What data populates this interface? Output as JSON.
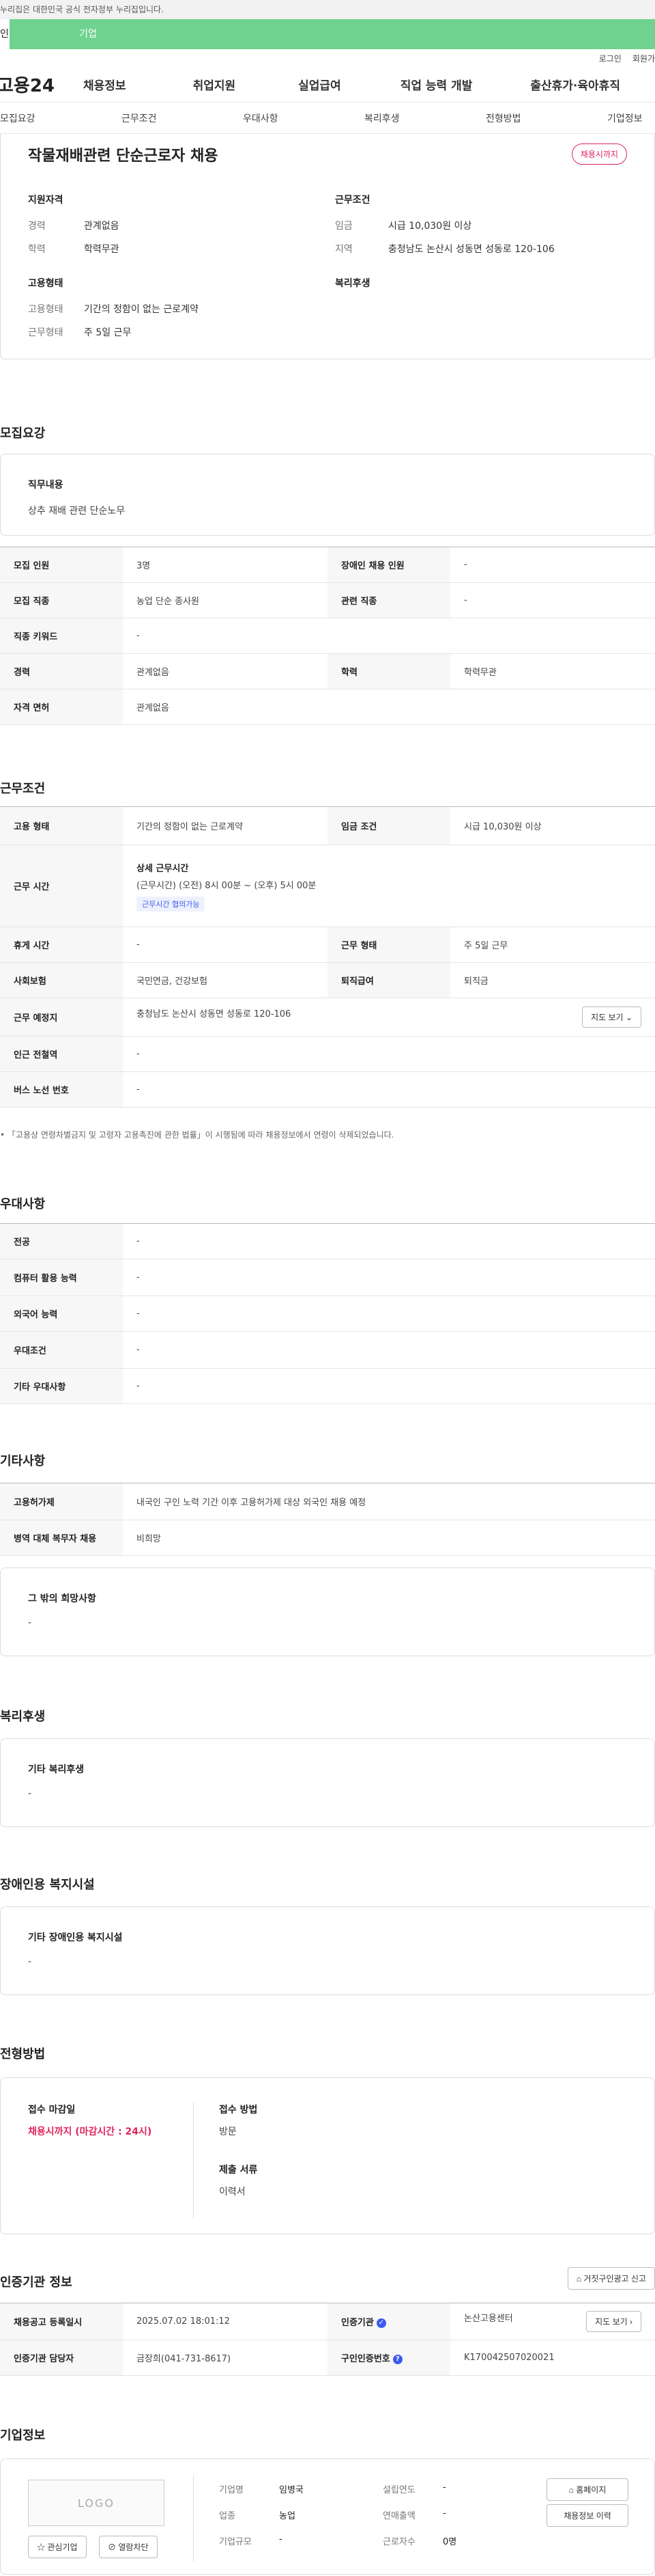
{
  "gov_bar": "누리집은 대한민국 공식 전자정부 누리집입니다.",
  "user_tabs": [
    "인",
    "기업"
  ],
  "util": {
    "login": "로그인",
    "join": "회원가"
  },
  "logo": "고용24",
  "gnb": [
    "채용정보",
    "취업지원",
    "실업급여",
    "직업 능력 개발",
    "출산휴가·육아휴직"
  ],
  "anchor_nav": [
    "모집요강",
    "근무조건",
    "우대사항",
    "복리후생",
    "전형방법",
    "기업정보"
  ],
  "summary": {
    "title": "작물재배관련 단순근로자 채용",
    "badge": "채용시까지",
    "qual_heading": "지원자격",
    "career_k": "경력",
    "career_v": "관계없음",
    "edu_k": "학력",
    "edu_v": "학력무관",
    "emp_heading": "고용형태",
    "emptype_k": "고용형태",
    "emptype_v": "기간의 정함이 없는 근로계약",
    "worktype_k": "근무형태",
    "worktype_v": "주 5일 근무",
    "cond_heading": "근무조건",
    "wage_k": "임금",
    "wage_v": "시급 10,030원 이상",
    "region_k": "지역",
    "region_v": "충청남도 논산시 성동면 성동로 120-106",
    "welfare_heading": "복리후생"
  },
  "recruit": {
    "heading": "모집요강",
    "job_label": "직무내용",
    "job_value": "상추 재배 관련 단순노무",
    "rows": [
      {
        "k1": "모집 인원",
        "v1": "3명",
        "k2": "장애인 채용 인원",
        "v2": "-"
      },
      {
        "k1": "모집 직종",
        "v1": "농업 단순 종사원",
        "k2": "관련 직종",
        "v2": "-"
      },
      {
        "k1": "직종 키워드",
        "v1": "-"
      },
      {
        "k1": "경력",
        "v1": "관계없음",
        "k2": "학력",
        "v2": "학력무관"
      },
      {
        "k1": "자격 면허",
        "v1": "관계없음"
      }
    ]
  },
  "work": {
    "heading": "근무조건",
    "emptype_k": "고용 형태",
    "emptype_v": "기간의 정함이 없는 근로계약",
    "wagecond_k": "임금 조건",
    "wagecond_v": "시급 10,030원 이상",
    "time_k": "근무 시간",
    "time_title": "상세 근무시간",
    "time_v": "(근무시간) (오전) 8시 00분 ~ (오후) 5시 00분",
    "time_chip": "근무시간 협의가능",
    "rest_k": "휴게 시간",
    "rest_v": "-",
    "form_k": "근무 형태",
    "form_v": "주 5일 근무",
    "ins_k": "사회보험",
    "ins_v": "국민연금, 건강보험",
    "sev_k": "퇴직급여",
    "sev_v": "퇴직금",
    "place_k": "근무 예정지",
    "place_v": "충청남도 논산시 성동면 성동로 120-106",
    "map_btn": "지도 보기",
    "subway_k": "인근 전철역",
    "subway_v": "-",
    "bus_k": "버스 노선 번호",
    "bus_v": "-",
    "note": "「고용상 연령차별금지 및 고령자 고용촉진에 관한 법률」이 시행됨에 따라 채용정보에서 연령이 삭제되었습니다."
  },
  "pref": {
    "heading": "우대사항",
    "rows": [
      {
        "k": "전공",
        "v": "-"
      },
      {
        "k": "컴퓨터 활용 능력",
        "v": "-"
      },
      {
        "k": "외국어 능력",
        "v": "-"
      },
      {
        "k": "우대조건",
        "v": "-"
      },
      {
        "k": "기타 우대사항",
        "v": "-"
      }
    ]
  },
  "etc": {
    "heading": "기타사항",
    "rows": [
      {
        "k": "고용허가제",
        "v": "내국인 구인 노력 기간 이후 고용허가제 대상 외국인 채용 예정"
      },
      {
        "k": "병역 대체 복무자 채용",
        "v": "비희망"
      }
    ],
    "other_label": "그 밖의 희망사항",
    "other_value": "-"
  },
  "welfare": {
    "heading": "복리후생",
    "label": "기타 복리후생",
    "value": "-"
  },
  "disability": {
    "heading": "장애인용 복지시설",
    "label": "기타 장애인용 복지시설",
    "value": "-"
  },
  "selection": {
    "heading": "전형방법",
    "deadline_label": "접수 마감일",
    "deadline_value": "채용시까지 (마감시간 : 24시)",
    "method_label": "접수 방법",
    "method_value": "방문",
    "docs_label": "제출 서류",
    "docs_value": "이력서"
  },
  "agency": {
    "heading": "인증기관 정보",
    "report_btn": "거짓구인광고 신고",
    "reg_k": "채용공고 등록일시",
    "reg_v": "2025.07.02 18:01:12",
    "org_k": "인증기관",
    "org_v": "논산고용센터",
    "map_btn": "지도 보기",
    "mgr_k": "인증기관 담당자",
    "mgr_v": "금장희(041-731-8617)",
    "no_k": "구인인증번호",
    "no_v": "K170042507020021"
  },
  "company": {
    "heading": "기업정보",
    "logo": "LOGO",
    "fav_btn": "관심기업",
    "block_btn": "열람차단",
    "name_k": "기업명",
    "name_v": "임병국",
    "founded_k": "설립연도",
    "founded_v": "-",
    "industry_k": "업종",
    "industry_v": "농업",
    "revenue_k": "연매출액",
    "revenue_v": "-",
    "scale_k": "기업규모",
    "scale_v": "-",
    "staff_k": "근로자수",
    "staff_v": "0명",
    "homepage_btn": "홈페이지",
    "history_btn": "채용정보 이력"
  }
}
